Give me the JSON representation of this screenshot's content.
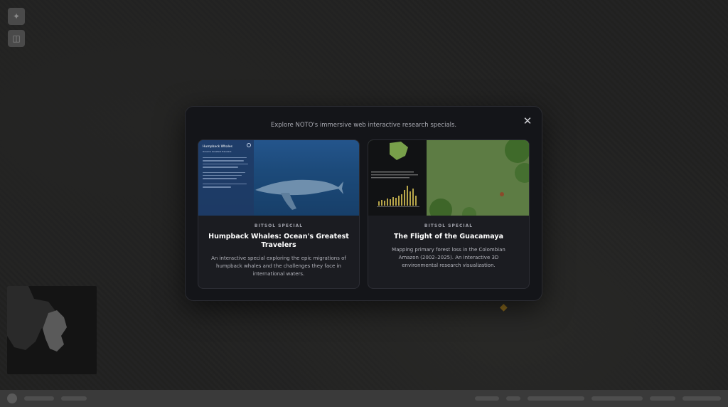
{
  "modal": {
    "subtitle": "Explore NOTO's immersive web interactive research specials.",
    "close_glyph": "✕"
  },
  "cards": [
    {
      "tag": "BITSOL SPECIAL",
      "title": "Humpback Whales: Ocean's Greatest Travelers",
      "description": "An interactive special exploring the epic migrations of humpback whales and the challenges they face in international waters.",
      "thumb": {
        "panel_title": "Humpback Whales",
        "panel_subtitle": "Ocean's Greatest Travelers"
      }
    },
    {
      "tag": "BITSOL SPECIAL",
      "title": "The Flight of the Guacamaya",
      "description": "Mapping primary forest loss in the Colombian Amazon (2002–2025). An interactive 3D environmental research visualization."
    }
  ],
  "map_controls": {
    "control_1_icon": "compass-icon",
    "control_2_icon": "layers-icon"
  },
  "colors": {
    "modal_bg": "#141519",
    "card_bg": "#1b1c21",
    "ocean": "#1c4a7a",
    "forest": "#5f7d43"
  }
}
